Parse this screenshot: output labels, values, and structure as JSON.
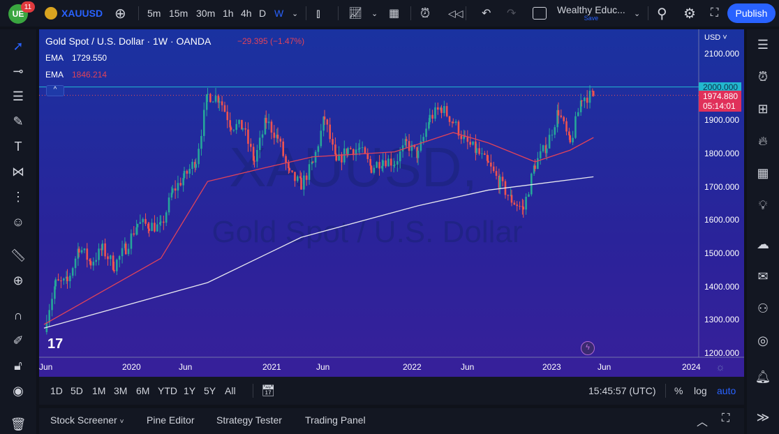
{
  "topbar": {
    "badge": "11",
    "symbol": "XAUUSD",
    "intervals": [
      "5m",
      "15m",
      "30m",
      "1h",
      "4h",
      "D",
      "W"
    ],
    "active_interval": "W",
    "layout_name": "Wealthy Educ...",
    "save_label": "Save",
    "publish_label": "Publish"
  },
  "legend": {
    "title": "Gold Spot / U.S. Dollar · 1W · OANDA",
    "change": "−29.395 (−1.47%)",
    "ema1_label": "EMA",
    "ema1_value": "1729.550",
    "ema2_label": "EMA",
    "ema2_value": "1846.214"
  },
  "watermark": {
    "symbol": "XAUUSD,",
    "name": "Gold Spot / U.S. Dollar"
  },
  "price_axis": {
    "currency": "USD",
    "ticks": [
      "2100.000",
      "1900.000",
      "1800.000",
      "1700.000",
      "1600.000",
      "1500.000",
      "1400.000",
      "1300.000",
      "1200.000"
    ],
    "hline_label": "2000.000",
    "last_price": "1974.880",
    "countdown": "05:14:01"
  },
  "time_axis": {
    "labels": [
      "Jun",
      "2020",
      "Jun",
      "2021",
      "Jun",
      "2022",
      "Jun",
      "2023",
      "Jun",
      "2024"
    ]
  },
  "rangebar": {
    "ranges": [
      "1D",
      "5D",
      "1M",
      "3M",
      "6M",
      "YTD",
      "1Y",
      "5Y",
      "All"
    ],
    "time": "15:45:57 (UTC)",
    "percent": "%",
    "log": "log",
    "auto": "auto"
  },
  "bottom": {
    "tabs": [
      "Stock Screener",
      "Pine Editor",
      "Strategy Tester",
      "Trading Panel"
    ]
  },
  "colors": {
    "up": "#26a69a",
    "down": "#ef5350",
    "hline": "#22b8cf",
    "ema_fast": "#e0435a",
    "ema_slow": "#e8e8f0",
    "accent": "#2962ff"
  },
  "chart_data": {
    "type": "candlestick",
    "title": "Gold Spot / U.S. Dollar · 1W · OANDA",
    "x_unit": "months since end of May 2019",
    "ylim": [
      1200,
      2100
    ],
    "monthly_closes": [
      1283,
      1409,
      1413,
      1520,
      1472,
      1512,
      1463,
      1517,
      1589,
      1585,
      1577,
      1686,
      1730,
      1780,
      1975,
      1967,
      1886,
      1879,
      1776,
      1898,
      1847,
      1734,
      1707,
      1769,
      1906,
      1770,
      1814,
      1813,
      1757,
      1783,
      1774,
      1829,
      1796,
      1908,
      1937,
      1896,
      1837,
      1807,
      1765,
      1711,
      1660,
      1633,
      1768,
      1824,
      1928,
      1827,
      1969,
      1975
    ],
    "ema_slow": [
      [
        0,
        1275
      ],
      [
        14,
        1412
      ],
      [
        22,
        1548
      ],
      [
        32,
        1643
      ],
      [
        38,
        1690
      ],
      [
        47,
        1730
      ]
    ],
    "ema_fast": [
      [
        0,
        1286
      ],
      [
        10,
        1485
      ],
      [
        14,
        1716
      ],
      [
        19,
        1758
      ],
      [
        23,
        1790
      ],
      [
        30,
        1805
      ],
      [
        35,
        1863
      ],
      [
        38,
        1832
      ],
      [
        42,
        1775
      ],
      [
        45,
        1810
      ],
      [
        47,
        1848
      ]
    ],
    "hline": 2000,
    "last": 1974.88
  }
}
